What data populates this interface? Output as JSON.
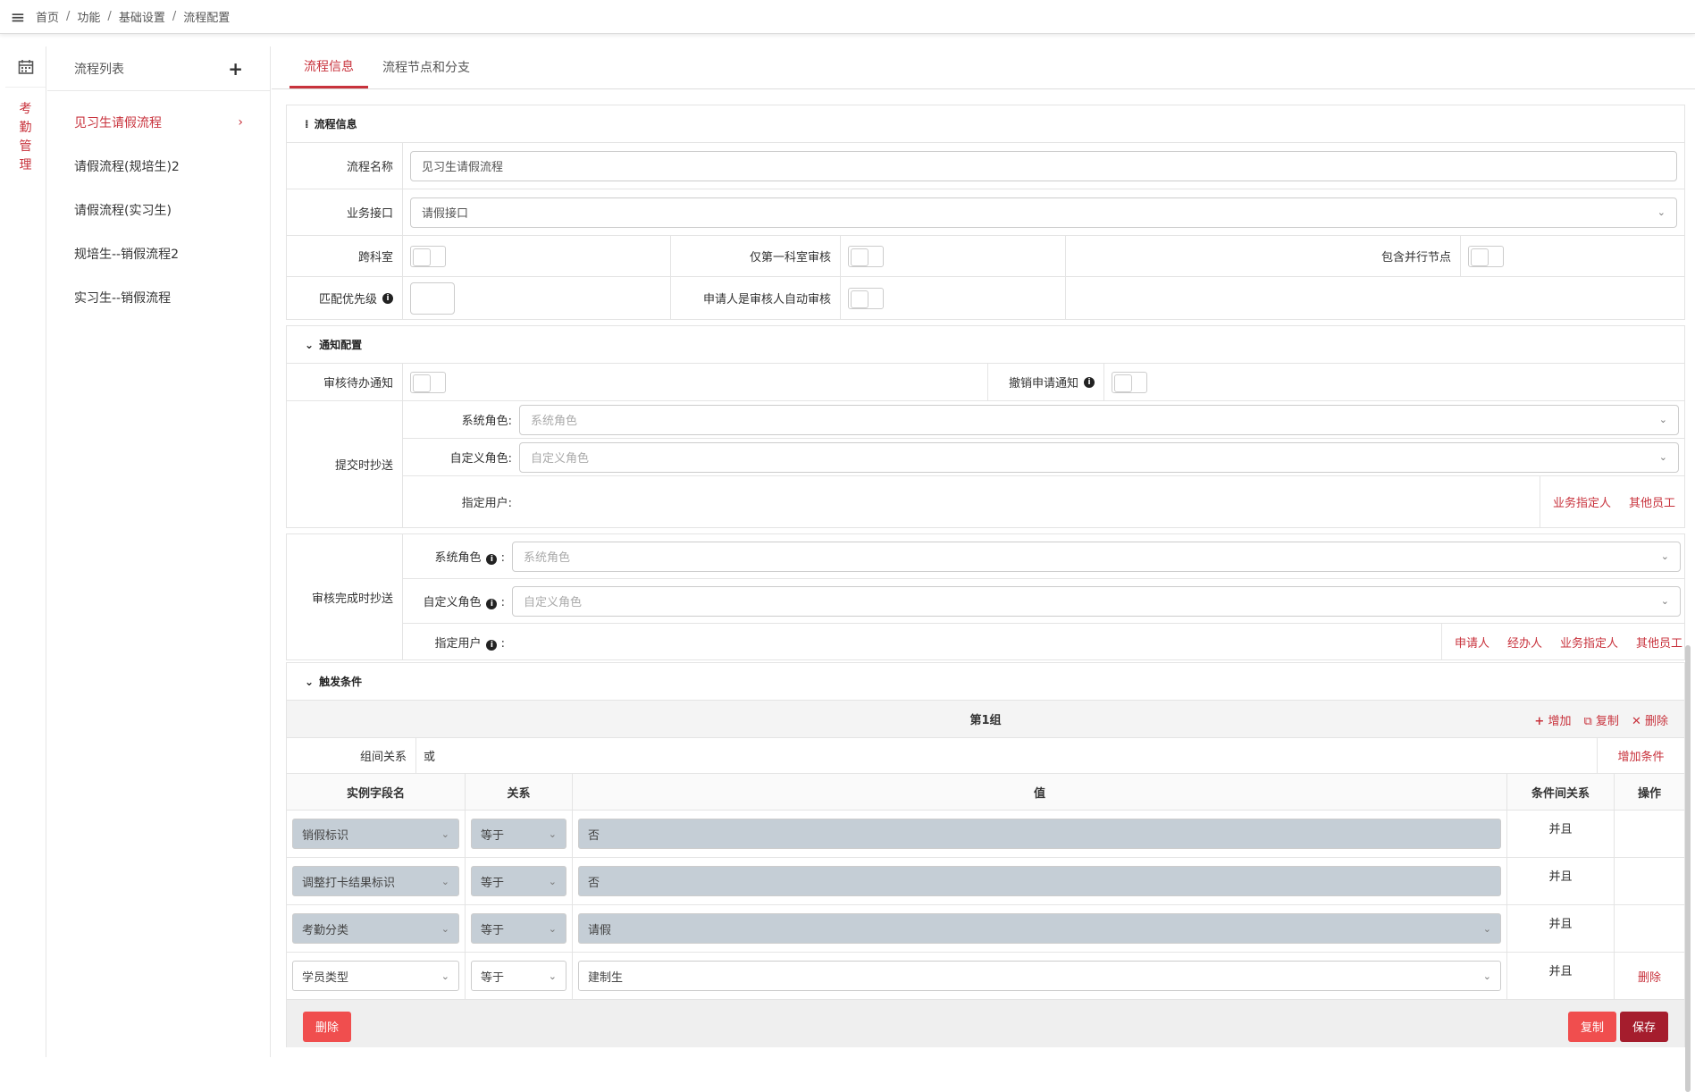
{
  "breadcrumb": [
    "首页",
    "功能",
    "基础设置",
    "流程配置"
  ],
  "module": {
    "label": "考勤管理"
  },
  "flow_list": {
    "title": "流程列表",
    "items": [
      {
        "label": "见习生请假流程",
        "active": true
      },
      {
        "label": "请假流程(规培生)2"
      },
      {
        "label": "请假流程(实习生)"
      },
      {
        "label": "规培生--销假流程2"
      },
      {
        "label": "实习生--销假流程"
      }
    ]
  },
  "tabs": [
    {
      "label": "流程信息",
      "active": true
    },
    {
      "label": "流程节点和分支"
    }
  ],
  "flow_info": {
    "section_title": "流程信息",
    "name_label": "流程名称",
    "name_value": "见习生请假流程",
    "api_label": "业务接口",
    "api_value": "请假接口",
    "cross_dept_label": "跨科室",
    "first_dept_only_label": "仅第一科室审核",
    "parallel_label": "包含并行节点",
    "priority_label": "匹配优先级",
    "auto_approve_label": "申请人是审核人自动审核"
  },
  "notify": {
    "section_title": "通知配置",
    "pending_label": "审核待办通知",
    "revoke_label": "撤销申请通知",
    "submit_cc": {
      "label": "提交时抄送",
      "sys_role_label": "系统角色:",
      "sys_role_placeholder": "系统角色",
      "custom_role_label": "自定义角色:",
      "custom_role_placeholder": "自定义角色",
      "user_label": "指定用户:",
      "links": [
        "业务指定人",
        "其他员工"
      ]
    },
    "done_cc": {
      "label": "审核完成时抄送",
      "sys_role_label": "系统角色",
      "sys_role_placeholder": "系统角色",
      "custom_role_label": "自定义角色",
      "custom_role_placeholder": "自定义角色",
      "user_label": "指定用户",
      "colon": ":",
      "links": [
        "申请人",
        "经办人",
        "业务指定人",
        "其他员工"
      ]
    }
  },
  "trigger": {
    "section_title": "触发条件",
    "group_title": "第1组",
    "group_actions": [
      "增加",
      "复制",
      "删除"
    ],
    "relation_label": "组间关系",
    "relation_value": "或",
    "add_condition": "增加条件",
    "columns": [
      "实例字段名",
      "关系",
      "值",
      "条件间关系",
      "操作"
    ],
    "rows": [
      {
        "field": "销假标识",
        "op": "等于",
        "value": "否",
        "logic": "并且",
        "action": "",
        "value_select": false,
        "white": false
      },
      {
        "field": "调整打卡结果标识",
        "op": "等于",
        "value": "否",
        "logic": "并且",
        "action": "",
        "value_select": false,
        "white": false
      },
      {
        "field": "考勤分类",
        "op": "等于",
        "value": "请假",
        "logic": "并且",
        "action": "",
        "value_select": true,
        "white": false
      },
      {
        "field": "学员类型",
        "op": "等于",
        "value": "建制生",
        "logic": "并且",
        "action": "删除",
        "value_select": true,
        "white": true
      }
    ]
  },
  "footer": {
    "delete": "删除",
    "copy": "复制",
    "save": "保存"
  },
  "colors": {
    "accent": "#c8323c",
    "save": "#a51d2d",
    "danger": "#f04e4e"
  }
}
